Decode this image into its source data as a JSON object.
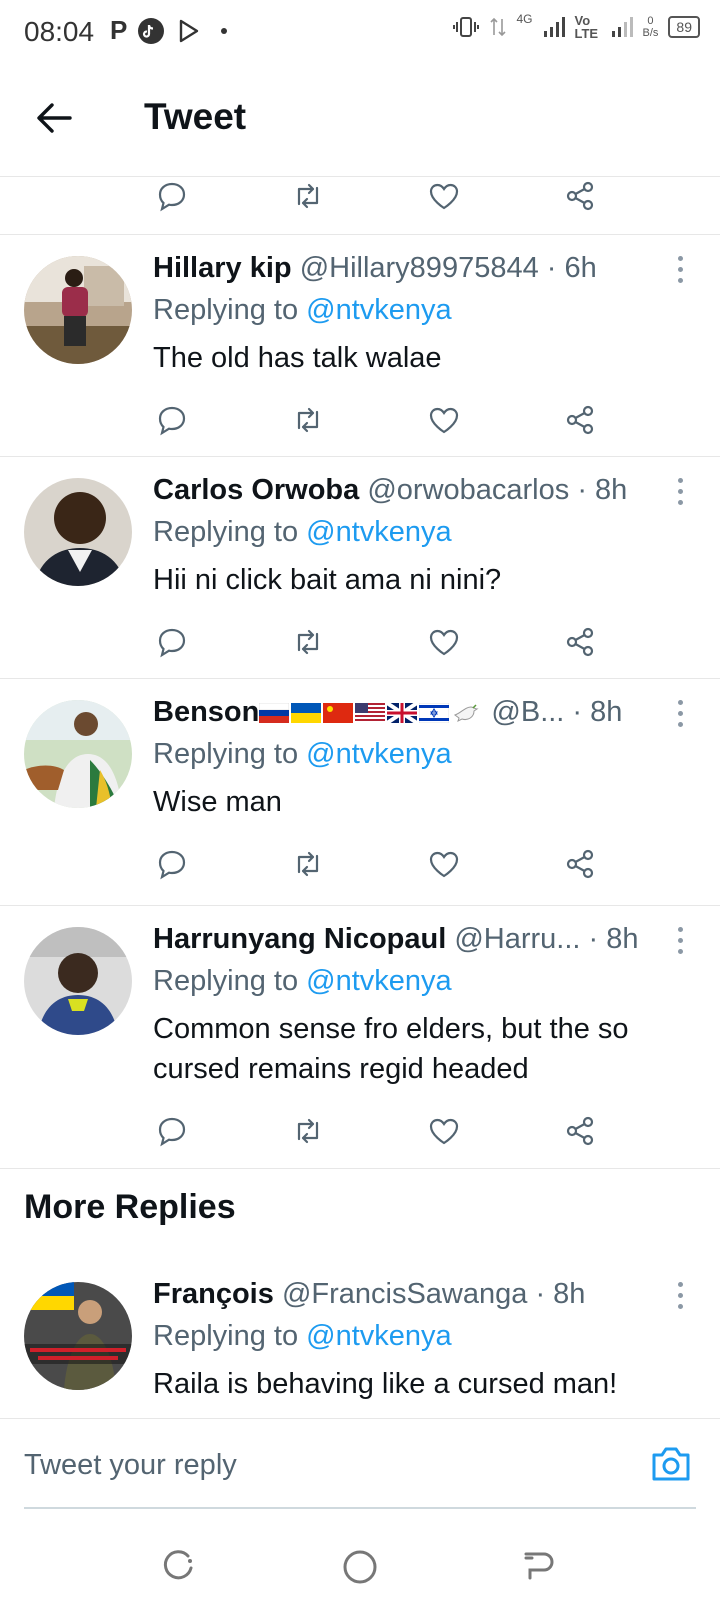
{
  "status_bar": {
    "time": "08:04",
    "network_4g": "4G",
    "volte": "Vo LTE",
    "speed_value": "0",
    "speed_unit": "B/s",
    "battery": "89"
  },
  "header": {
    "title": "Tweet"
  },
  "tweets": [
    {
      "name": "Hillary kip",
      "handle": "@Hillary89975844",
      "time": "· 6h",
      "replying_prefix": "Replying to",
      "replying_to": "@ntvkenya",
      "text": "The old has talk walae"
    },
    {
      "name": "Carlos Orwoba",
      "handle": "@orwobacarlos",
      "time": "· 8h",
      "replying_prefix": "Replying to",
      "replying_to": "@ntvkenya",
      "text": "Hii ni click bait ama ni nini?"
    },
    {
      "name": "Benson",
      "handle": "@B...",
      "time": "· 8h",
      "replying_prefix": "Replying to",
      "replying_to": "@ntvkenya",
      "text": "Wise man"
    },
    {
      "name": "Harrunyang Nicopaul",
      "handle": "@Harru...",
      "time": "· 8h",
      "replying_prefix": "Replying to",
      "replying_to": "@ntvkenya",
      "text": "Common sense fro elders, but the so cursed remains regid headed"
    },
    {
      "name": "François",
      "handle": "@FrancisSawanga",
      "time": "· 8h",
      "replying_prefix": "Replying to",
      "replying_to": "@ntvkenya",
      "text": "Raila is behaving like a cursed man!"
    }
  ],
  "more_replies_title": "More Replies",
  "composer": {
    "placeholder": "Tweet your reply"
  },
  "colors": {
    "link": "#1d9bf0",
    "muted": "#536471",
    "text": "#0f1419"
  }
}
